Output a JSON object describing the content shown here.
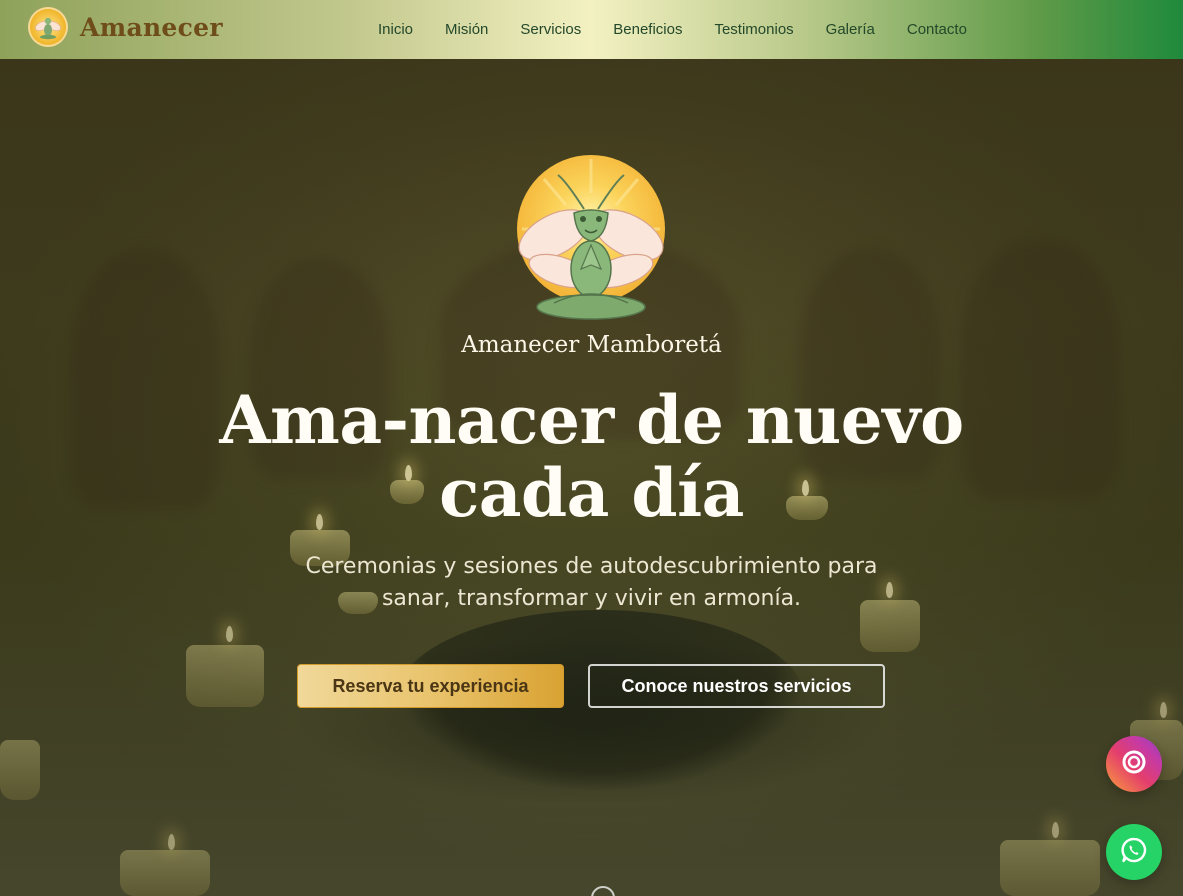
{
  "header": {
    "brand_name": "Amanecer",
    "brand_logo_icon": "praying-mantis-logo-icon",
    "nav": [
      {
        "label": "Inicio"
      },
      {
        "label": "Misión"
      },
      {
        "label": "Servicios"
      },
      {
        "label": "Beneficios"
      },
      {
        "label": "Testimonios"
      },
      {
        "label": "Galería"
      },
      {
        "label": "Contacto"
      }
    ]
  },
  "hero": {
    "logo_icon": "praying-mantis-sun-icon",
    "brand": "Amanecer Mamboretá",
    "title_line1": "Ama-nacer de nuevo",
    "title_line2": "cada día",
    "subtitle_line1": "Ceremonias y sesiones de autodescubrimiento para",
    "subtitle_line2": "sanar, transformar y vivir en armonía.",
    "primary_button": "Reserva tu experiencia",
    "secondary_button": "Conoce nuestros servicios"
  },
  "floating": {
    "instagram_icon": "instagram-icon",
    "whatsapp_icon": "whatsapp-icon"
  },
  "colors": {
    "accent_gold": "#e9c46d",
    "header_green": "#1f8a3c",
    "whatsapp_green": "#25d366",
    "brand_brown": "#6e4d1a"
  }
}
